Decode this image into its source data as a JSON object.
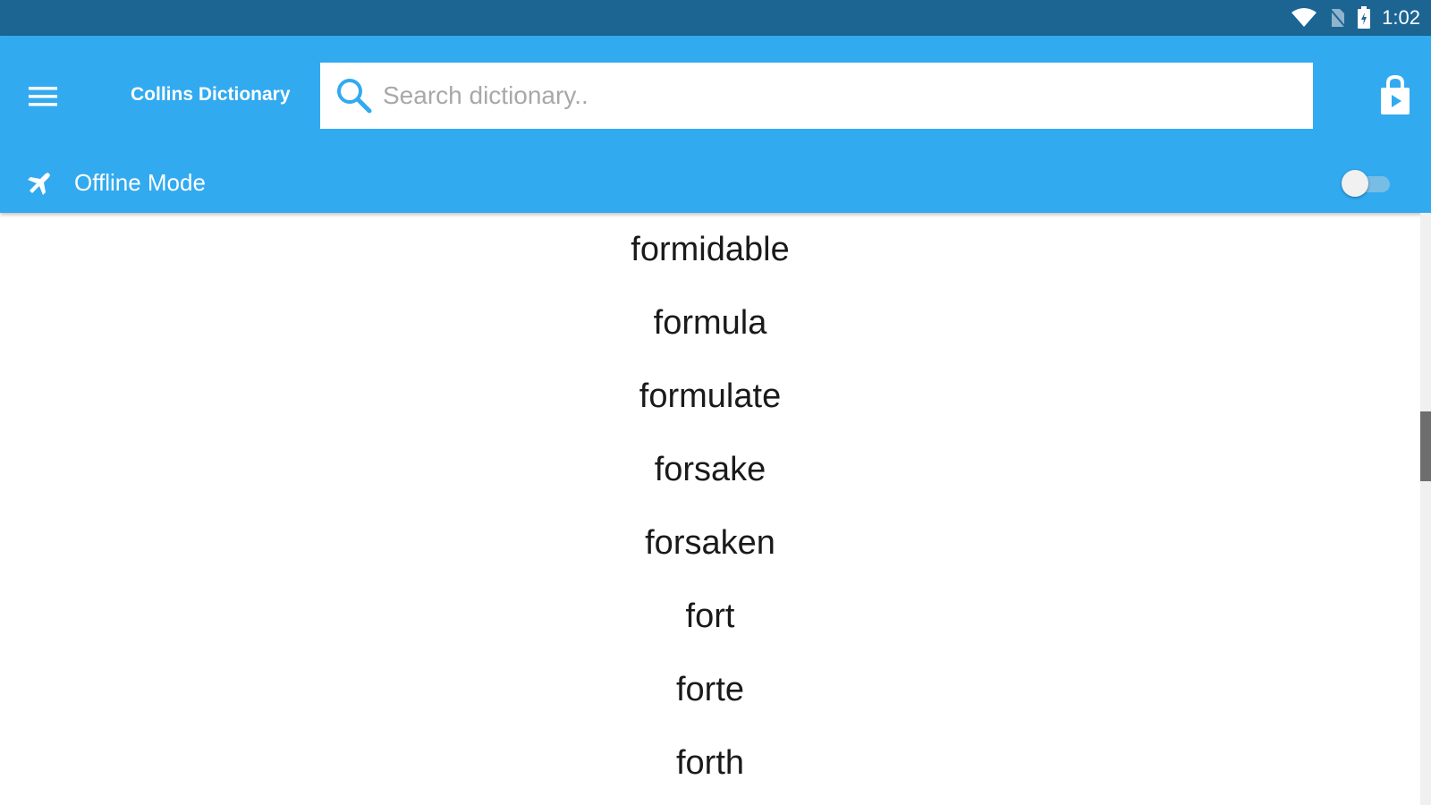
{
  "status_bar": {
    "time": "1:02",
    "icons": [
      "wifi-icon",
      "no-sim-icon",
      "battery-icon"
    ]
  },
  "app_bar": {
    "menu_icon": "hamburger-menu-icon",
    "title": "Collins Dictionary",
    "search": {
      "icon": "search-icon",
      "placeholder": "Search dictionary..",
      "value": ""
    },
    "store_icon": "play-store-bag-icon"
  },
  "offline": {
    "icon": "airplane-icon",
    "label": "Offline Mode",
    "enabled": false
  },
  "words": [
    "formidable",
    "formula",
    "formulate",
    "forsake",
    "forsaken",
    "fort",
    "forte",
    "forth"
  ],
  "colors": {
    "status_bar": "#1c6593",
    "app_bar": "#32aaf0",
    "accent_icon": "#32aaf0",
    "text": "#1a1a1a"
  }
}
